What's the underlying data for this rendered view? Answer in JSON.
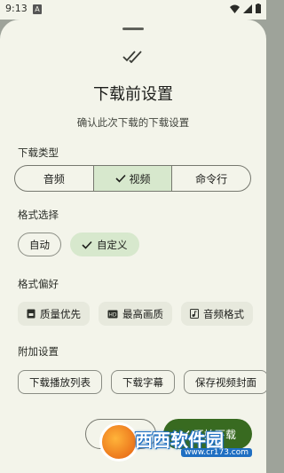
{
  "status_bar": {
    "time": "9:13",
    "notification_badge": "A"
  },
  "sheet": {
    "title": "下载前设置",
    "subtitle": "确认此次下载的下载设置"
  },
  "download_type": {
    "label": "下载类型",
    "options": [
      "音频",
      "视频",
      "命令行"
    ],
    "selected": "视频"
  },
  "format_select": {
    "label": "格式选择",
    "options": [
      "自动",
      "自定义"
    ],
    "selected": "自定义"
  },
  "format_preference": {
    "label": "格式偏好",
    "chips": [
      "质量优先",
      "最高画质",
      "音频格式"
    ]
  },
  "additional": {
    "label": "附加设置",
    "chips": [
      "下载播放列表",
      "下载字幕",
      "保存视频封面"
    ]
  },
  "actions": {
    "cancel": "取消",
    "start": "开始下载"
  },
  "watermark": {
    "text": "西西软件园",
    "sub": "www.cr173.com"
  },
  "colors": {
    "background": "#f3f4ea",
    "selected": "#d7e8cd",
    "primary": "#386a20"
  }
}
